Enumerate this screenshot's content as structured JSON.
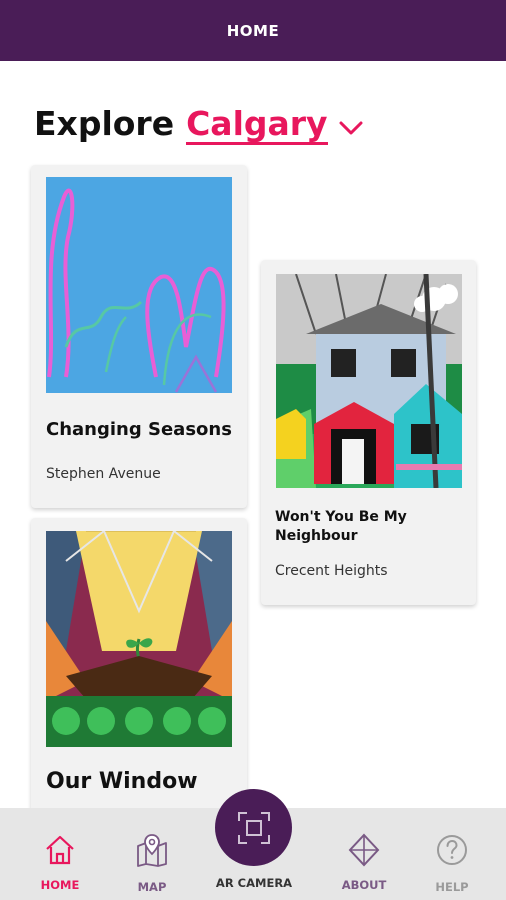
{
  "colors": {
    "brand": "#4a1d57",
    "accent": "#e8175d",
    "nav_inactive": "#7a5a85",
    "nav_disabled": "#9a9a9a"
  },
  "header": {
    "title": "HOME"
  },
  "explore": {
    "prefix": "Explore",
    "city": "Calgary",
    "caret_icon": "chevron-down-icon"
  },
  "cards": [
    {
      "title": "Changing Seasons",
      "location": "Stephen Avenue",
      "art": "abstract-blue-painting"
    },
    {
      "title": "Won't You Be My Neighbour",
      "location": "Crecent Heights",
      "art": "colorful-house-mural"
    },
    {
      "title": "Our Window",
      "location": "",
      "art": "stained-glass-sprout-mural"
    }
  ],
  "nav": {
    "items": [
      {
        "label": "HOME",
        "icon": "home-icon",
        "state": "active"
      },
      {
        "label": "MAP",
        "icon": "map-pin-icon",
        "state": "inactive"
      },
      {
        "label": "AR CAMERA",
        "icon": "scan-frame-icon",
        "state": "inactive"
      },
      {
        "label": "ABOUT",
        "icon": "diamond-compass-icon",
        "state": "inactive"
      },
      {
        "label": "HELP",
        "icon": "help-circle-icon",
        "state": "disabled"
      }
    ]
  }
}
